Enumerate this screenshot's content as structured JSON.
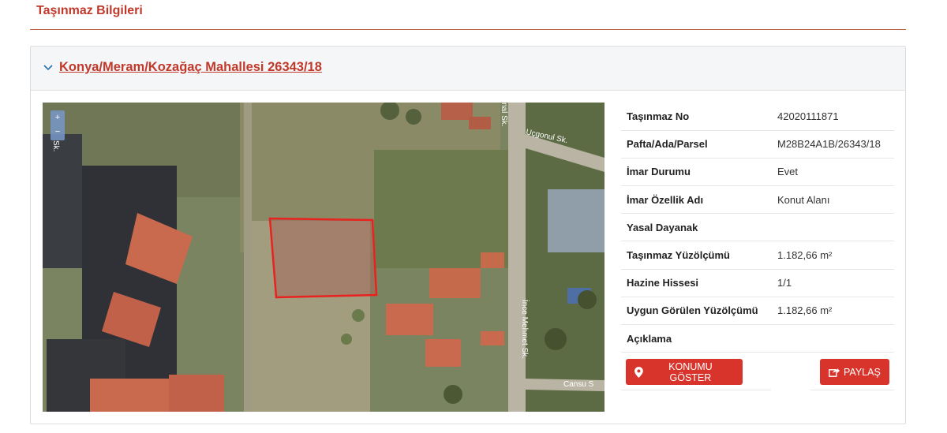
{
  "section": {
    "title": "Taşınmaz Bilgileri"
  },
  "panel": {
    "link_text": "Konya/Meram/Kozağaç Mahallesi 26343/18"
  },
  "map": {
    "zoom_in": "+",
    "zoom_out": "−",
    "street_labels": [
      "Uçgonul Sk.",
      "İnce Mehmet Sk.",
      "Cansu S",
      "nal Sk.",
      "Sk."
    ]
  },
  "info": {
    "rows": [
      {
        "key": "Taşınmaz No",
        "value": "42020111871"
      },
      {
        "key": "Pafta/Ada/Parsel",
        "value": "M28B24A1B/26343/18"
      },
      {
        "key": "İmar Durumu",
        "value": "Evet"
      },
      {
        "key": "İmar Özellik Adı",
        "value": "Konut Alanı"
      },
      {
        "key": "Yasal Dayanak",
        "value": ""
      },
      {
        "key": "Taşınmaz Yüzölçümü",
        "value": "1.182,66 m²"
      },
      {
        "key": "Hazine Hissesi",
        "value": "1/1"
      },
      {
        "key": "Uygun Görülen Yüzölçümü",
        "value": "1.182,66 m²"
      },
      {
        "key": "Açıklama",
        "value": ""
      }
    ]
  },
  "buttons": {
    "show_location": "KONUMU GÖSTER",
    "share": "PAYLAŞ"
  },
  "colors": {
    "accent": "#c0392b",
    "button": "#d9342b",
    "parcel_outline": "#e8231f"
  }
}
